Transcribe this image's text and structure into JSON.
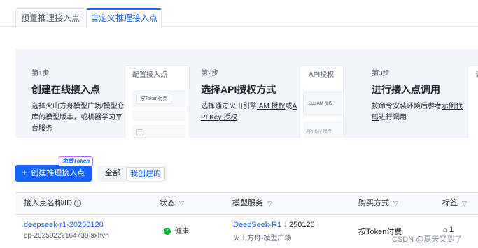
{
  "tabs": [
    {
      "label": "预置推理接入点",
      "active": false
    },
    {
      "label": "自定义推理接入点",
      "active": true
    }
  ],
  "steps": [
    {
      "num": "第1步",
      "title": "创建在线接入点",
      "desc": [
        "选择火山方舟模型广场/模型仓",
        "库的模型版本，或机器学习平",
        "台服务"
      ],
      "card": {
        "head": "配置接入点",
        "chip": "按Token付费"
      }
    },
    {
      "num": "第2步",
      "title": "选择API授权方式",
      "desc_l1_pre": "选择通过火山引擎",
      "desc_l1_link1": "IAM 授权",
      "desc_l1_mid": "或",
      "desc_l1_link2": "A",
      "desc_l2_link": "PI Key 授权",
      "card": {
        "head": "API授权",
        "chip1": "火山IAM 授权",
        "chip2": "API Key 授权"
      }
    },
    {
      "num": "第3步",
      "title": "进行接入点调用",
      "desc_l1_pre": "按命令安装环境后参考",
      "desc_l1_link": "示例代",
      "desc_l2_link": "码",
      "desc_l2_post": "进行调用",
      "card": {
        "head": "调"
      }
    }
  ],
  "toolbar": {
    "create_label": "创建推理接入点",
    "create_icon": "plus-icon",
    "free_tag": "免费Token",
    "filter_all": "全部",
    "filter_mine": "我创建的"
  },
  "table": {
    "headers": {
      "name": "接入点名称/ID",
      "status": "状态",
      "model": "模型服务",
      "billing": "购买方式",
      "tags": "标签"
    },
    "rows": [
      {
        "name": "deepseek-r1-20250120",
        "id": "ep-20250222164738-sxhvh",
        "status": "健康",
        "model_name": "DeepSeek-R1",
        "model_version": "250120",
        "model_source": "火山方舟-模型广场",
        "billing": "按Token付费",
        "tag_count": "1"
      }
    ]
  },
  "watermark": "CSDN @夏天又到了",
  "colors": {
    "accent": "#1664ff",
    "healthy": "#00b42a",
    "banner_bg": "#f2f5fc"
  }
}
